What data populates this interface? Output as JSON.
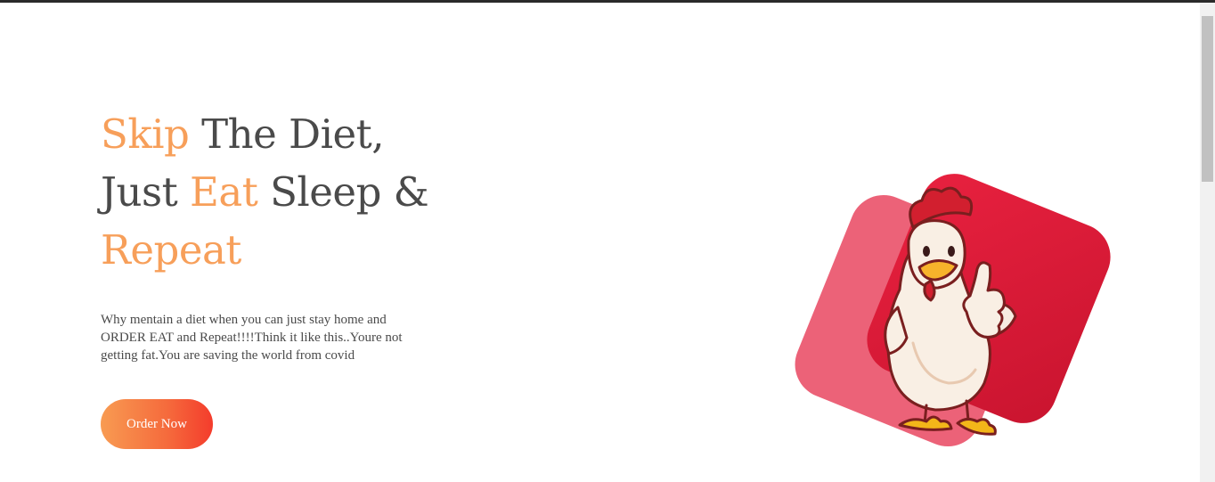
{
  "hero": {
    "headline": {
      "line1_accent": "Skip",
      "line1_rest": " The Diet,",
      "line2_start": "Just ",
      "line2_accent": "Eat",
      "line2_rest": " Sleep &",
      "line3_accent": "Repeat"
    },
    "description": "Why mentain a diet when you can just stay home and ORDER EAT and Repeat!!!!Think it like this..Youre not getting fat.You are saving the world from covid",
    "cta_label": "Order Now",
    "illustration": "chicken-thumbs-up-mascot"
  },
  "colors": {
    "accent": "#f79f5a",
    "text": "#4a4a4a",
    "button_gradient_start": "#f89b52",
    "button_gradient_end": "#f43c2c",
    "card_back": "#ec6278",
    "card_front": "#e31d3d"
  }
}
